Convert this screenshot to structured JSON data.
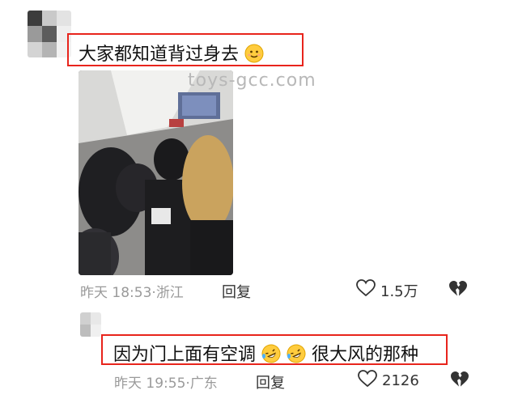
{
  "watermark": "toys-gcc.com",
  "comments": [
    {
      "text": "大家都知道背过身去",
      "emoji": "slightly-smiling-face-icon",
      "time": "昨天 18:53",
      "location": "浙江",
      "reply_label": "回复",
      "likes": "1.5万"
    },
    {
      "text_before": "因为门上面有空调",
      "text_after": "很大风的那种",
      "emoji": "rolling-on-floor-laughing-icon",
      "time": "昨天 19:55",
      "location": "广东",
      "reply_label": "回复",
      "likes": "2126"
    }
  ],
  "colors": {
    "highlight_border": "#e8241c",
    "meta_text": "#9a9a9a",
    "emoji_yellow": "#ffcc3e"
  }
}
